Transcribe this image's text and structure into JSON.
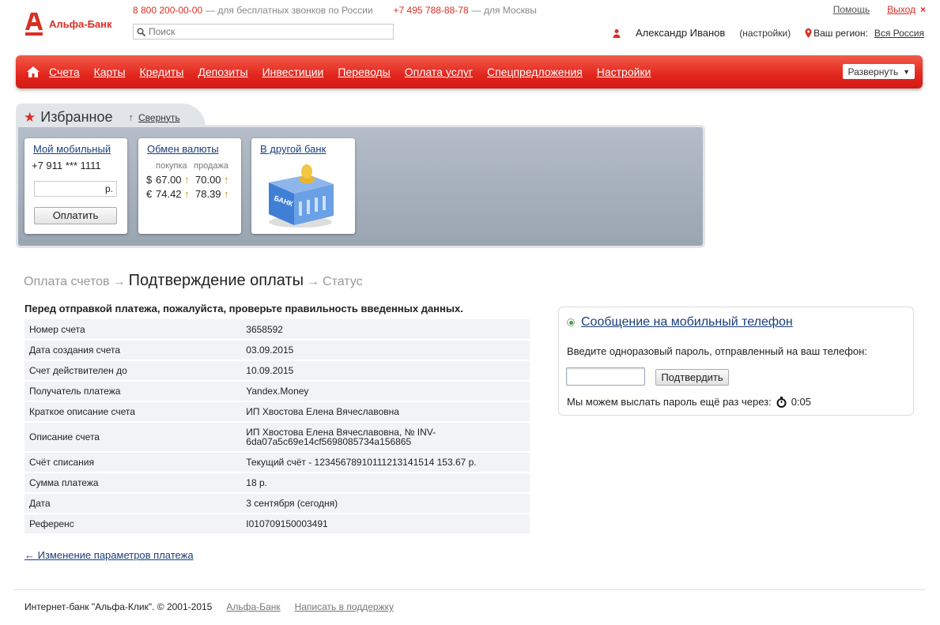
{
  "brand": {
    "name": "Альфа-Банк",
    "color": "#d92f25"
  },
  "header": {
    "phone_free": "8 800 200-00-00",
    "phone_free_note": "— для бесплатных звонков по России",
    "phone_moscow": "+7 495 788-88-78",
    "phone_moscow_note": "— для Москвы",
    "search_placeholder": "Поиск",
    "help": "Помощь",
    "exit": "Выход",
    "user_name": "Александр Иванов",
    "user_settings": "(настройки)",
    "region_label": "Ваш регион:",
    "region_value": "Вся Россия"
  },
  "nav": {
    "items": [
      "Счета",
      "Карты",
      "Кредиты",
      "Депозиты",
      "Инвестиции",
      "Переводы",
      "Оплата услуг",
      "Спецпредложения",
      "Настройки"
    ],
    "expand": "Развернуть"
  },
  "favorites": {
    "title": "Избранное",
    "collapse": "Свернуть",
    "mobile": {
      "title": "Мой мобильный",
      "number": "+7 911 *** 1111",
      "currency": "р.",
      "pay": "Оплатить"
    },
    "fx": {
      "title": "Обмен валюты",
      "buy_label": "покупка",
      "sell_label": "продажа",
      "rows": [
        {
          "cur": "$",
          "buy": "67.00",
          "sell": "70.00"
        },
        {
          "cur": "€",
          "buy": "74.42",
          "sell": "78.39"
        }
      ]
    },
    "other_bank": {
      "title": "В другой банк",
      "img_label": "БАНК"
    }
  },
  "steps": {
    "step1": "Оплата счетов",
    "arrow": "→",
    "step2": "Подтверждение оплаты",
    "step3": "Статус"
  },
  "intro": "Перед отправкой платежа, пожалуйста, проверьте правильность введенных данных.",
  "details": [
    {
      "k": "Номер счета",
      "v": "3658592"
    },
    {
      "k": "Дата создания счета",
      "v": "03.09.2015"
    },
    {
      "k": "Счет действителен до",
      "v": "10.09.2015"
    },
    {
      "k": "Получатель платежа",
      "v": "Yandex.Money"
    },
    {
      "k": "Краткое описание счета",
      "v": "ИП Хвостова Елена Вячеславовна"
    },
    {
      "k": "Описание счета",
      "v": "ИП Хвостова Елена Вячеславовна, № INV-6da07a5c69e14cf5698085734a156865"
    },
    {
      "k": "Счёт списания",
      "v": "Текущий счёт - 12345678910111213141514 153.67 р."
    },
    {
      "k": "Сумма платежа",
      "v": "18 р."
    },
    {
      "k": "Дата",
      "v": "3 сентября (сегодня)"
    },
    {
      "k": "Референс",
      "v": "I010709150003491"
    }
  ],
  "back_link": "← Изменение параметров платежа",
  "sms": {
    "title": "Сообщение на мобильный телефон",
    "hint": "Введите одноразовый пароль, отправленный на ваш телефон:",
    "confirm": "Подтвердить",
    "resend": "Мы можем выслать пароль ещё раз через:",
    "timer": "0:05"
  },
  "footer": {
    "copyright": "Интернет-банк \"Альфа-Клик\". © 2001-2015",
    "bank_link": "Альфа-Банк",
    "support_link": "Написать в поддержку"
  }
}
